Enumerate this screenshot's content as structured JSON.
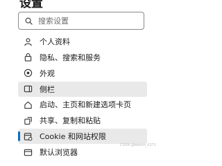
{
  "header": {
    "title": "设置"
  },
  "search": {
    "placeholder": "搜索设置"
  },
  "nav": {
    "items": [
      {
        "label": "个人资料",
        "icon": "profile-icon"
      },
      {
        "label": "隐私、搜索和服务",
        "icon": "lock-icon"
      },
      {
        "label": "外观",
        "icon": "appearance-icon"
      },
      {
        "label": "侧栏",
        "icon": "sidebar-icon"
      },
      {
        "label": "启动、主页和新建选项卡页",
        "icon": "home-icon"
      },
      {
        "label": "共享、复制和粘贴",
        "icon": "share-icon"
      },
      {
        "label": "Cookie 和网站权限",
        "icon": "site-permissions-icon"
      },
      {
        "label": "默认浏览器",
        "icon": "browser-icon"
      }
    ]
  },
  "colors": {
    "accent": "#0f6cbd",
    "highlight": "#e9e9e9"
  },
  "watermark": "CSDN @weixin_0371"
}
